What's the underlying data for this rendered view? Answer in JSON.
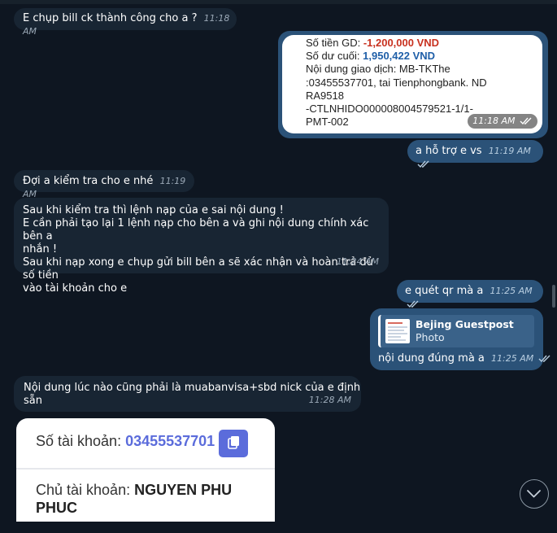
{
  "messages": {
    "m1": {
      "text": "E chụp bill ck thành công cho a ?",
      "time": "11:18 AM"
    },
    "receipt": {
      "amount_label": "Số tiền GD: ",
      "amount_value": "-1,200,000 VND",
      "balance_label": "Số dư cuối: ",
      "balance_value": "1,950,422 VND",
      "content_lines": [
        "Nội dung giao dịch: MB-TKThe",
        ":03455537701, tai Tienphongbank. ND",
        "RA9518",
        "-CTLNHIDO000008004579521-1/1-",
        "PMT-002"
      ],
      "time": "11:18 AM"
    },
    "m3": {
      "text": "a hỗ trợ e vs",
      "time": "11:19 AM"
    },
    "m4": {
      "text": "Đợi a kiểm tra cho e nhé",
      "time": "11:19 AM"
    },
    "m5": {
      "lines": [
        "Sau khi kiểm tra thì lệnh nạp của e sai nội dung !",
        "E cần phải tạo lại 1 lệnh nạp cho bên a và ghi nội dung chính xác bên a",
        "nhắn !",
        "Sau khi nạp xong e chụp gửi bill bên a sẽ xác nhận và hoàn trả đủ số tiền",
        "vào tài khoản cho e"
      ],
      "time": "11:24 AM"
    },
    "m6": {
      "text": "e quét qr mà a",
      "time": "11:25 AM"
    },
    "m7": {
      "reply_title": "Bejing Guestpost",
      "reply_sub": "Photo",
      "text": "nội dung đúng mà a",
      "time": "11:25 AM"
    },
    "m8": {
      "text": "Nội dung lúc nào cũng phải là muabanvisa+sbd nick của e định sẵn",
      "time": "11:28 AM"
    },
    "account_card": {
      "account_label": "Số tài khoản: ",
      "account_number": "03455537701",
      "holder_label": "Chủ tài khoản: ",
      "holder_name_line1": "NGUYEN PHU",
      "holder_name_line2": "PHUC"
    }
  },
  "colors": {
    "background": "#0e1621",
    "incoming_bubble": "#182533",
    "outgoing_bubble": "#2b5278",
    "accent": "#5b6cdb"
  },
  "icons": [
    "double-check-icon",
    "copy-icon",
    "chevron-down-icon",
    "photo-thumbnail"
  ]
}
